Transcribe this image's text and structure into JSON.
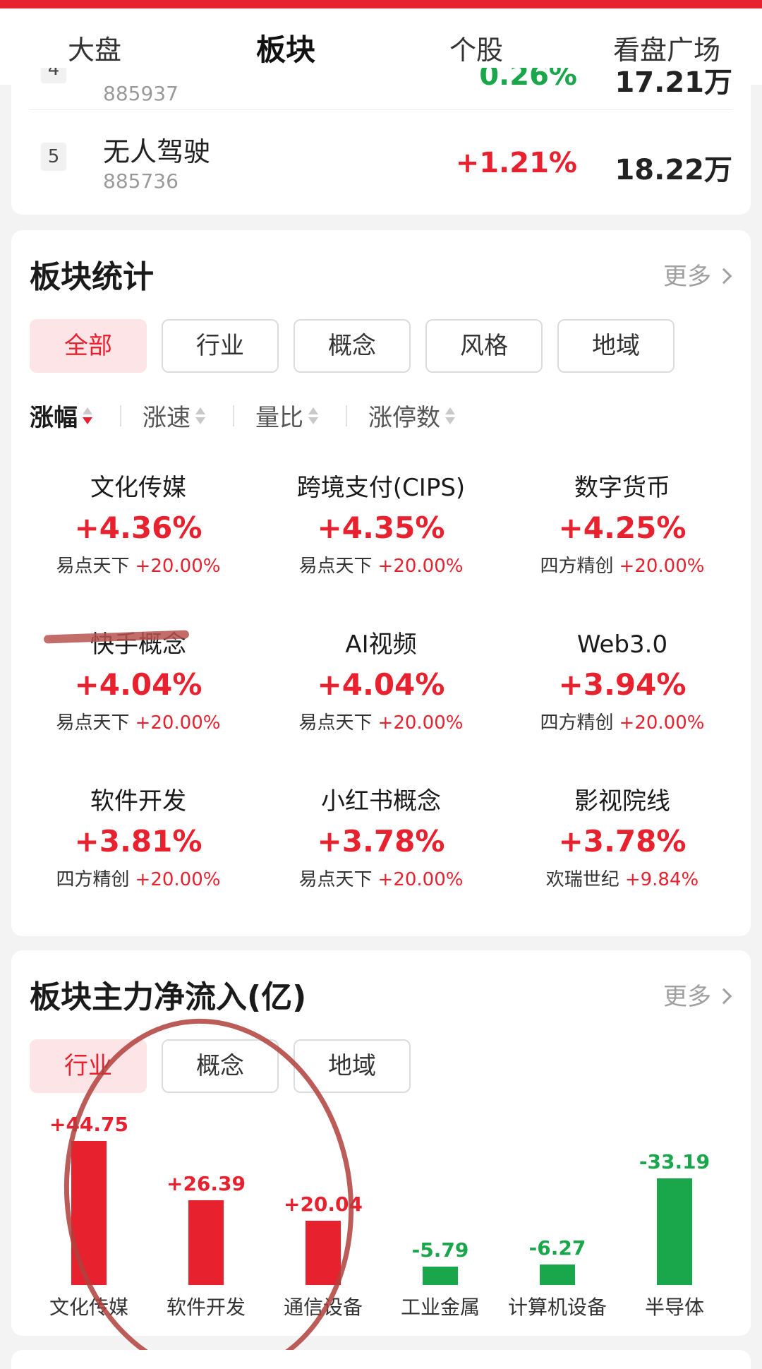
{
  "colors": {
    "accent": "#e8212f",
    "up": "#e8212f",
    "down": "#1aa64b"
  },
  "nav": {
    "tabs": [
      {
        "label": "大盘"
      },
      {
        "label": "板块"
      },
      {
        "label": "个股"
      },
      {
        "label": "看盘广场"
      }
    ],
    "active_index": 1
  },
  "ranking": {
    "rows": [
      {
        "rank": "4",
        "name": "",
        "code": "885937",
        "change": "0.26%",
        "amount": "17.21万"
      },
      {
        "rank": "5",
        "name": "无人驾驶",
        "code": "885736",
        "change": "+1.21%",
        "amount": "18.22万"
      }
    ]
  },
  "stats": {
    "title": "板块统计",
    "more": "更多",
    "filters": [
      "全部",
      "行业",
      "概念",
      "风格",
      "地域"
    ],
    "sorters": [
      "涨幅",
      "涨速",
      "量比",
      "涨停数"
    ],
    "cells": [
      {
        "name": "文化传媒",
        "change": "+4.36%",
        "leader": "易点天下",
        "leader_change": "+20.00%"
      },
      {
        "name": "跨境支付(CIPS)",
        "change": "+4.35%",
        "leader": "易点天下",
        "leader_change": "+20.00%"
      },
      {
        "name": "数字货币",
        "change": "+4.25%",
        "leader": "四方精创",
        "leader_change": "+20.00%"
      },
      {
        "name": "快手概念",
        "change": "+4.04%",
        "leader": "易点天下",
        "leader_change": "+20.00%"
      },
      {
        "name": "AI视频",
        "change": "+4.04%",
        "leader": "易点天下",
        "leader_change": "+20.00%"
      },
      {
        "name": "Web3.0",
        "change": "+3.94%",
        "leader": "四方精创",
        "leader_change": "+20.00%"
      },
      {
        "name": "软件开发",
        "change": "+3.81%",
        "leader": "四方精创",
        "leader_change": "+20.00%"
      },
      {
        "name": "小红书概念",
        "change": "+3.78%",
        "leader": "易点天下",
        "leader_change": "+20.00%"
      },
      {
        "name": "影视院线",
        "change": "+3.78%",
        "leader": "欢瑞世纪",
        "leader_change": "+9.84%"
      }
    ]
  },
  "flow": {
    "title": "板块主力净流入(亿)",
    "more": "更多",
    "filters": [
      "行业",
      "概念",
      "地域"
    ]
  },
  "chart_data": {
    "type": "bar",
    "title": "板块主力净流入(亿)",
    "categories": [
      "文化传媒",
      "软件开发",
      "通信设备",
      "工业金属",
      "计算机设备",
      "半导体"
    ],
    "values": [
      44.75,
      26.39,
      20.04,
      -5.79,
      -6.27,
      -33.19
    ],
    "labels": [
      "+44.75",
      "+26.39",
      "+20.04",
      "-5.79",
      "-6.27",
      "-33.19"
    ],
    "note_magnitude_drawn": true
  }
}
